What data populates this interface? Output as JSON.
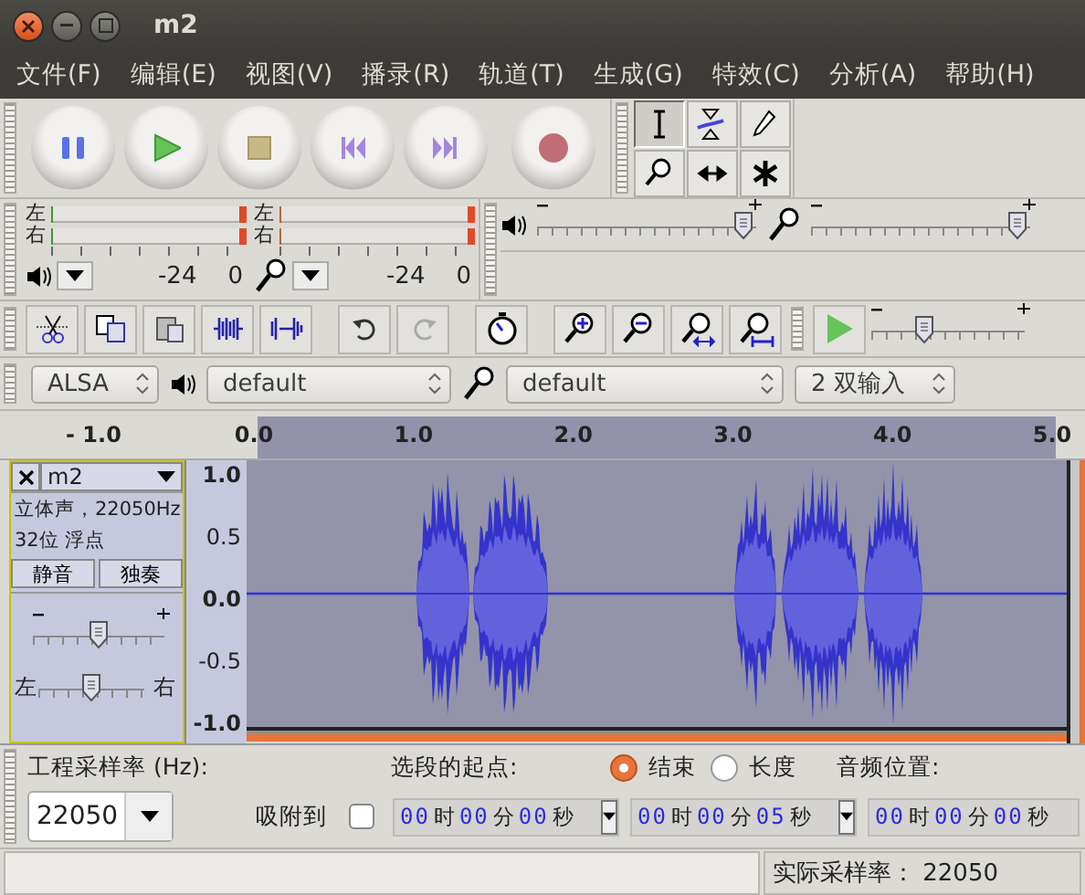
{
  "window": {
    "title": "m2"
  },
  "menu": [
    "文件(F)",
    "编辑(E)",
    "视图(V)",
    "播录(R)",
    "轨道(T)",
    "生成(G)",
    "特效(C)",
    "分析(A)",
    "帮助(H)"
  ],
  "tools": [
    {
      "selected": true
    },
    {
      "selected": false
    },
    {
      "selected": false
    },
    {
      "selected": false
    },
    {
      "selected": false
    },
    {
      "selected": false
    }
  ],
  "meters": [
    {
      "left": "左",
      "right": "右",
      "scale": [
        "-24",
        "0"
      ]
    },
    {
      "left": "左",
      "right": "右",
      "scale": [
        "-24",
        "0"
      ]
    }
  ],
  "mixer": {
    "output": {
      "level": 0.98
    },
    "input": {
      "level": 0.98
    }
  },
  "play_speed": {
    "level": 0.32
  },
  "devices": {
    "host": "ALSA",
    "output": "default",
    "input": "default",
    "channels": "2 双输入"
  },
  "ruler": [
    "- 1.0",
    "0.0",
    "1.0",
    "2.0",
    "3.0",
    "4.0",
    "5.0"
  ],
  "track": {
    "name": "m2",
    "info": [
      "立体声，22050Hz",
      "32位 浮点"
    ],
    "mute": "静音",
    "solo": "独奏",
    "gain": {
      "level": 0.5
    },
    "pan": {
      "left": "左",
      "right": "右",
      "level": 0.5
    },
    "scale": [
      "1.0",
      "0.5",
      "0.0",
      "-0.5",
      "-1.0"
    ]
  },
  "selection_bar": {
    "rate_label": "工程采样率 (Hz):",
    "rate": "22050",
    "snap_label": "吸附到",
    "snap": false,
    "start_label": "选段的起点:",
    "modes": [
      {
        "label": "结束",
        "selected": true
      },
      {
        "label": "长度",
        "selected": false
      }
    ],
    "position_label": "音频位置:",
    "times": [
      [
        {
          "value": "00",
          "unit": "时"
        },
        {
          "value": "00",
          "unit": "分"
        },
        {
          "value": "00",
          "unit": "秒"
        }
      ],
      [
        {
          "value": "00",
          "unit": "时"
        },
        {
          "value": "00",
          "unit": "分"
        },
        {
          "value": "05",
          "unit": "秒"
        }
      ],
      [
        {
          "value": "00",
          "unit": "时"
        },
        {
          "value": "00",
          "unit": "分"
        },
        {
          "value": "00",
          "unit": "秒"
        }
      ]
    ]
  },
  "status_bar": {
    "rate": "实际采样率： 22050"
  }
}
